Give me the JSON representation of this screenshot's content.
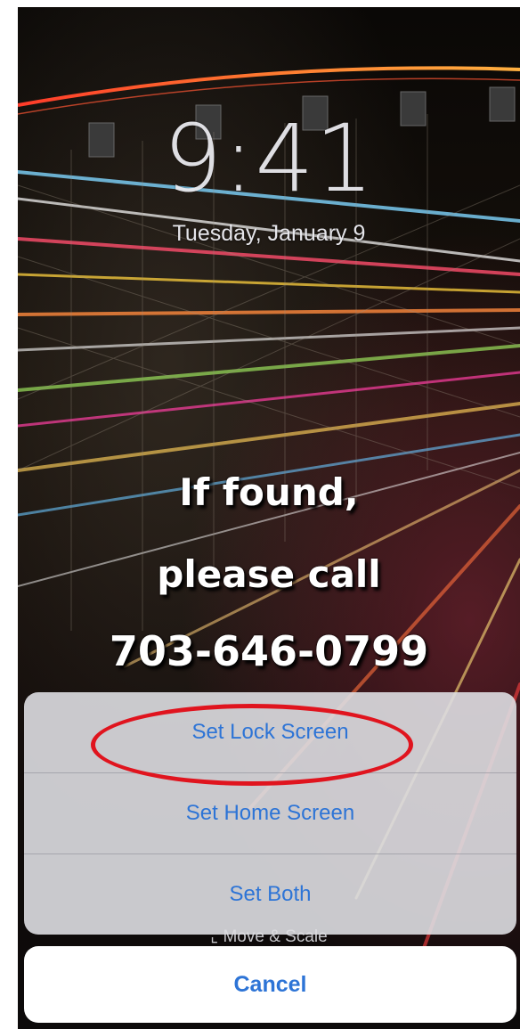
{
  "lockscreen": {
    "time": "9:41",
    "date": "Tuesday, January 9",
    "wallpaper_message": {
      "line1": "If found,",
      "line2": "please call",
      "line3": "703-646-0799"
    }
  },
  "action_sheet": {
    "options": [
      {
        "label": "Set Lock Screen"
      },
      {
        "label": "Set Home Screen"
      },
      {
        "label": "Set Both"
      }
    ],
    "cancel_label": "Cancel",
    "move_hint": "Move & Scale"
  },
  "colors": {
    "accent": "#2d74d6",
    "highlight_ring": "#e0141e"
  },
  "icons": {
    "move_scale": "crop-icon"
  }
}
